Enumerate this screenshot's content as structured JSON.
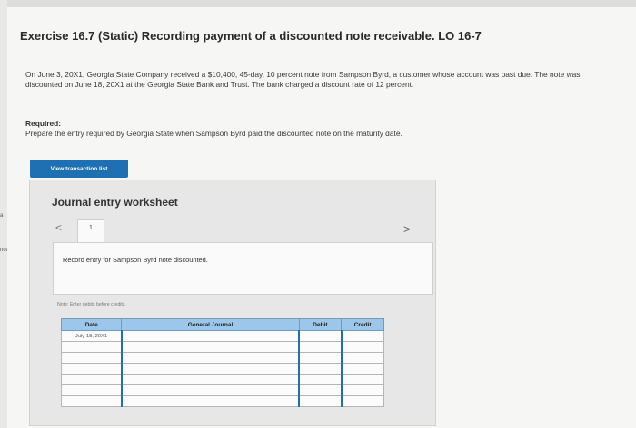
{
  "exercise": {
    "title": "Exercise 16.7 (Static) Recording payment of a discounted note receivable. LO 16-7",
    "description": "On June 3, 20X1, Georgia State Company received a $10,400, 45-day, 10 percent note from Sampson Byrd, a customer whose account was past due. The note was discounted on June 18, 20X1 at the Georgia State Bank and Trust. The bank charged a discount rate of 12 percent.",
    "required_label": "Required:",
    "required_text": "Prepare the entry required by Georgia State when Sampson Byrd paid the discounted note on the maturity date."
  },
  "toolbar": {
    "view_transaction_label": "View transaction list"
  },
  "worksheet": {
    "title": "Journal entry worksheet",
    "prev_glyph": "<",
    "next_glyph": ">",
    "tab_number": "1",
    "record_text": "Record entry for Sampson Byrd note discounted.",
    "note": "Note: Enter debits before credits.",
    "columns": {
      "date": "Date",
      "journal": "General Journal",
      "debit": "Debit",
      "credit": "Credit"
    },
    "first_date": "July 18, 20X1"
  },
  "edge": {
    "mark1": "a",
    "mark2": "nces"
  },
  "colors": {
    "button_blue": "#1f6fb3",
    "header_blue": "#9cc7ea"
  }
}
